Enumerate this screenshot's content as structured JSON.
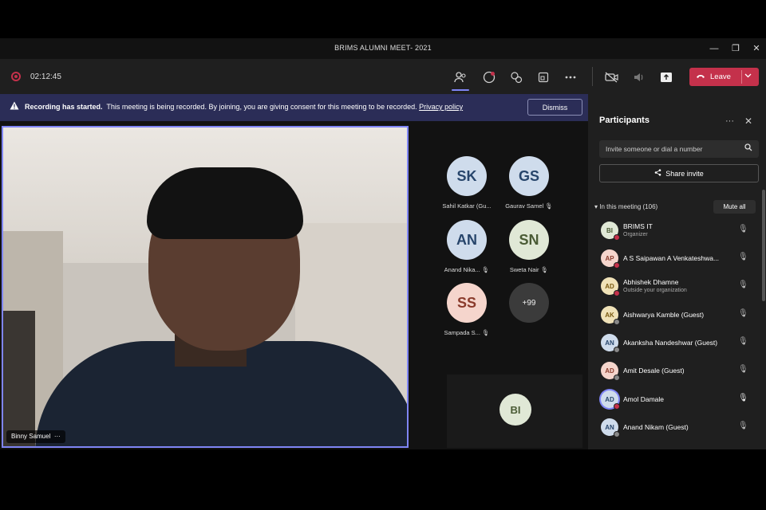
{
  "window": {
    "title": "BRIMS ALUMNI MEET- 2021",
    "controls": {
      "minimize": "—",
      "restore": "❐",
      "close": "✕"
    }
  },
  "toolbar": {
    "timer": "02:12:45",
    "leave_label": "Leave",
    "icons": [
      "people-icon",
      "chat-icon",
      "reactions-icon",
      "share-tray-icon",
      "more-icon",
      "camera-off-icon",
      "mic-off-icon",
      "share-content-icon",
      "phone-icon"
    ]
  },
  "banner": {
    "bold": "Recording has started.",
    "text": "This meeting is being recorded. By joining, you are giving consent for this meeting to be recorded.",
    "link": "Privacy policy",
    "dismiss": "Dismiss"
  },
  "stage": {
    "main_speaker": "Binny Samuel",
    "main_more": "···",
    "tiles": [
      {
        "initials": "SK",
        "name": "Sahil Katkar (Gu..."
      },
      {
        "initials": "GS",
        "name": "Gaurav Samel"
      },
      {
        "initials": "AN",
        "name": "Anand Nika..."
      },
      {
        "initials": "SN",
        "name": "Sweta Nair"
      },
      {
        "initials": "SS",
        "name": "Sampada S..."
      },
      {
        "initials": "+99",
        "name": ""
      }
    ],
    "bottom_tile": "BI"
  },
  "panel": {
    "title": "Participants",
    "search_placeholder": "Invite someone or dial a number",
    "share_invite": "Share invite",
    "in_meeting": "In this meeting (106)",
    "mute_all": "Mute all",
    "participants": [
      {
        "initials": "BI",
        "name": "BRIMS IT",
        "sub": "Organizer"
      },
      {
        "initials": "AP",
        "name": "A S Saipawan A Venkateshwa...",
        "sub": ""
      },
      {
        "initials": "AD",
        "name": "Abhishek Dhamne",
        "sub": "Outside your organization"
      },
      {
        "initials": "AK",
        "name": "Aishwarya Kamble (Guest)",
        "sub": ""
      },
      {
        "initials": "AN",
        "name": "Akanksha Nandeshwar (Guest)",
        "sub": ""
      },
      {
        "initials": "AD",
        "name": "Amit Desale (Guest)",
        "sub": ""
      },
      {
        "initials": "AD",
        "name": "Amol Damale",
        "sub": ""
      },
      {
        "initials": "AN",
        "name": "Anand Nikam (Guest)",
        "sub": ""
      }
    ]
  },
  "colors": {
    "accent": "#7f85f5",
    "leave": "#c4314b",
    "banner": "#2b2d57",
    "panel": "#1f1f1f"
  }
}
